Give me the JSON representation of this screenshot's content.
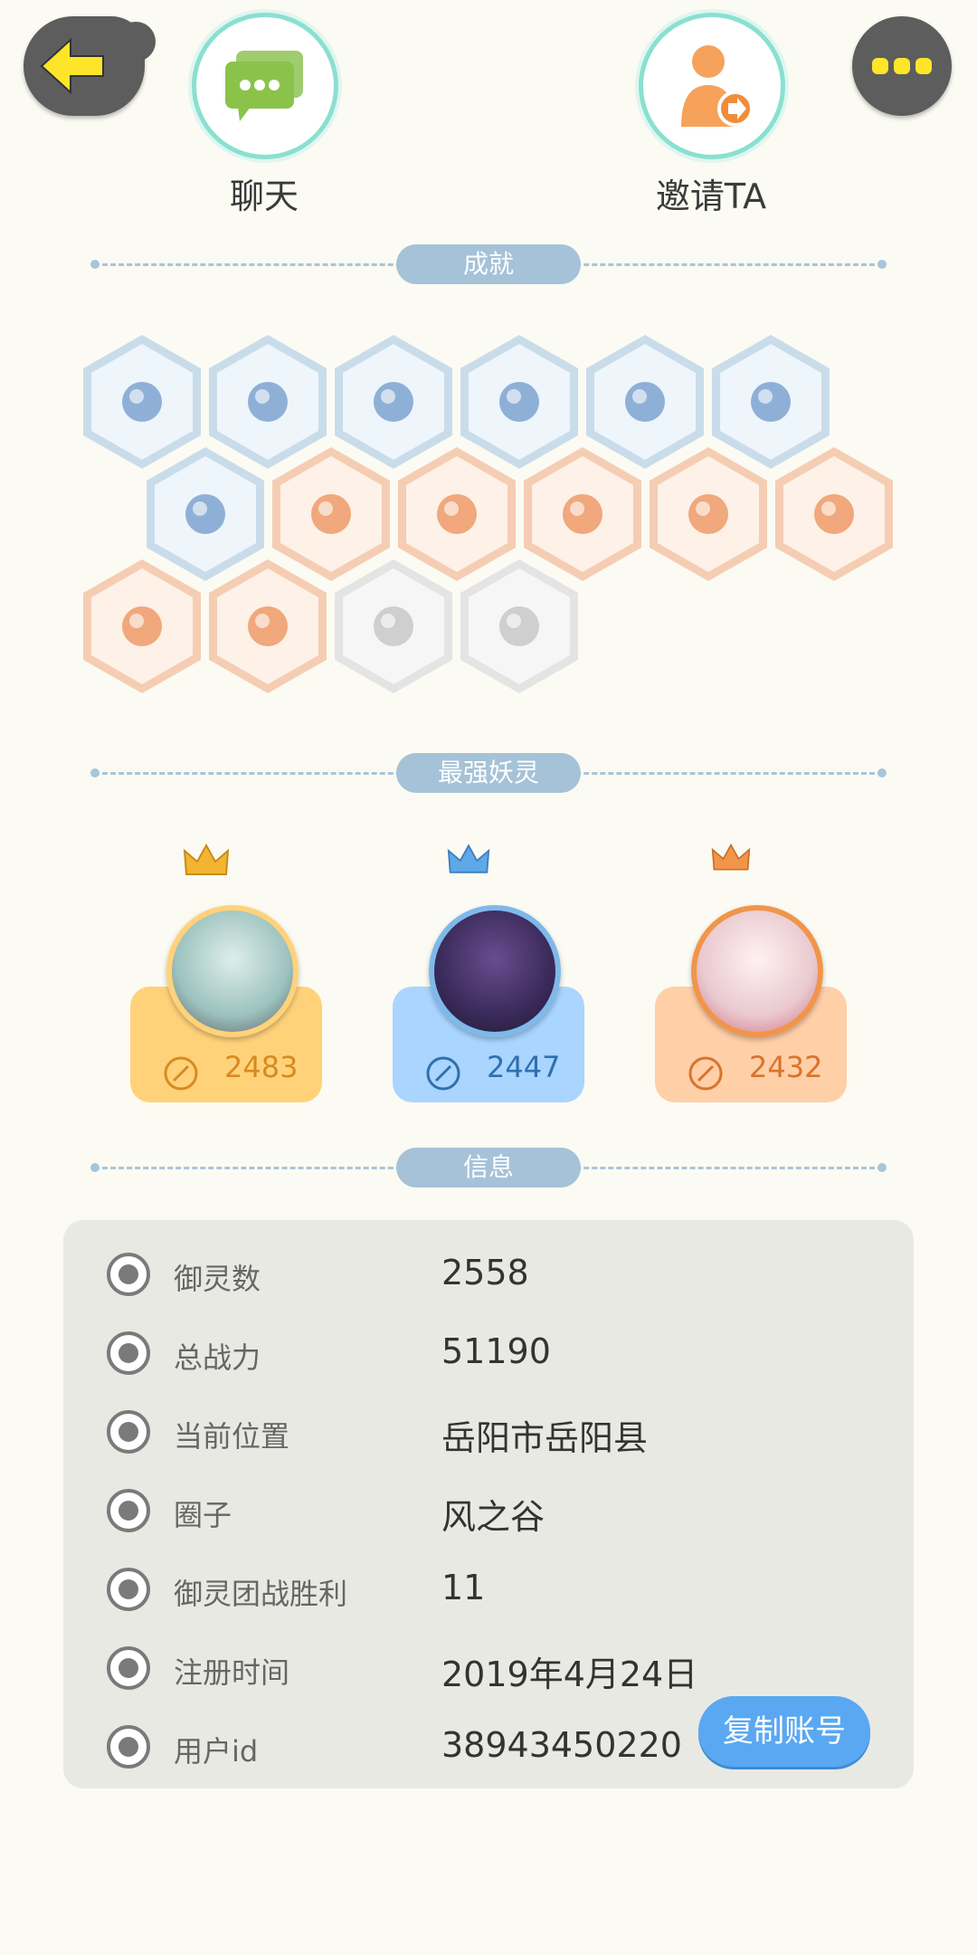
{
  "top": {
    "chat_label": "聊天",
    "invite_label": "邀请TA"
  },
  "sections": {
    "achievements": "成就",
    "strongest": "最强妖灵",
    "info": "信息"
  },
  "achievements": [
    {
      "icon": "sneaker-badge-icon",
      "tone": "blue"
    },
    {
      "icon": "orb-staff-badge-icon",
      "tone": "blue"
    },
    {
      "icon": "cat-mask-badge-icon",
      "tone": "blue"
    },
    {
      "icon": "moon-badge-icon",
      "tone": "blue"
    },
    {
      "icon": "bubble-badge-icon",
      "tone": "blue"
    },
    {
      "icon": "yin-yang-wave-badge-icon",
      "tone": "blue"
    },
    {
      "icon": "yin-yang-scroll-badge-icon",
      "tone": "blue"
    },
    {
      "icon": "crystal-badge-icon",
      "tone": "orange"
    },
    {
      "icon": "fox-badge-icon",
      "tone": "orange"
    },
    {
      "icon": "cat-cart-badge-icon",
      "tone": "orange"
    },
    {
      "icon": "cat-flower-badge-icon",
      "tone": "orange"
    },
    {
      "icon": "scroll-seal-badge-icon",
      "tone": "orange"
    },
    {
      "icon": "ox-badge-icon",
      "tone": "orange"
    },
    {
      "icon": "ghost-badge-icon",
      "tone": "orange"
    },
    {
      "icon": "dragon-badge-icon",
      "tone": "grey"
    },
    {
      "icon": "wolf-book-badge-icon",
      "tone": "grey"
    }
  ],
  "strongest": [
    {
      "power": "2483",
      "card_color": "#ffd27a",
      "text_color": "#d88a20",
      "crown": "gold"
    },
    {
      "power": "2447",
      "card_color": "#a9d5ff",
      "text_color": "#2f6fb0",
      "crown": "blue"
    },
    {
      "power": "2432",
      "card_color": "#ffcfa8",
      "text_color": "#d8742c",
      "crown": "orange"
    }
  ],
  "info": [
    {
      "key": "御灵数",
      "value": "2558",
      "icon": "spirit-icon"
    },
    {
      "key": "总战力",
      "value": "51190",
      "icon": "sword-icon"
    },
    {
      "key": "当前位置",
      "value": "岳阳市岳阳县",
      "icon": "location-pin-icon"
    },
    {
      "key": "圈子",
      "value": "风之谷",
      "icon": "circle-target-icon"
    },
    {
      "key": "御灵团战胜利",
      "value": "11",
      "icon": "trophy-sword-icon"
    },
    {
      "key": "注册时间",
      "value": "2019年4月24日",
      "icon": "clock-icon"
    },
    {
      "key": "用户id",
      "value": "38943450220",
      "icon": "id-card-icon"
    }
  ],
  "copy_button": "复制账号"
}
